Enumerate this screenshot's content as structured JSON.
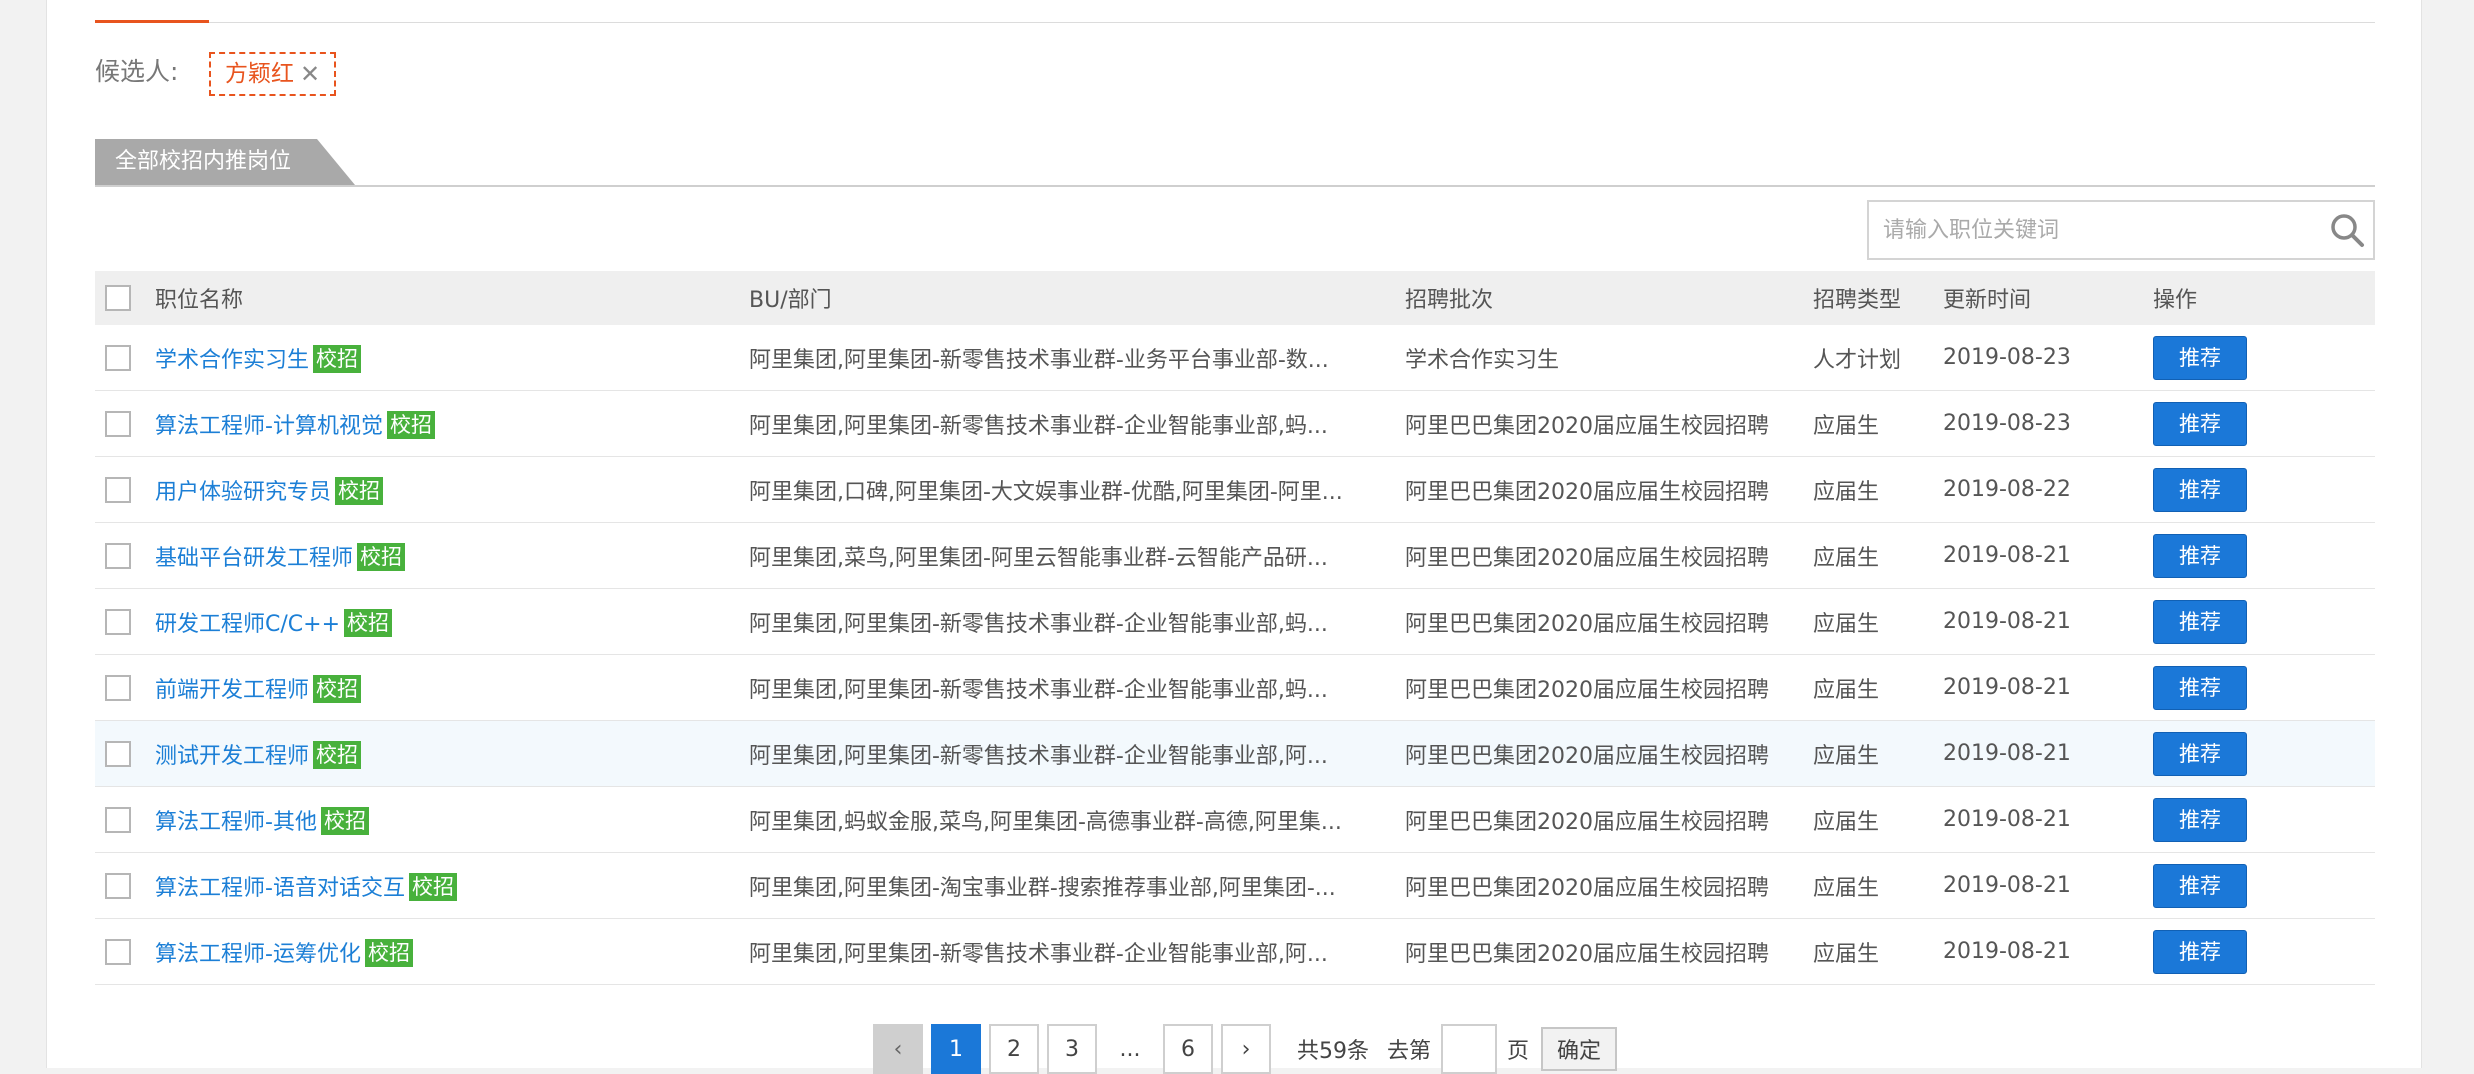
{
  "candidate": {
    "label": "候选人:",
    "name": "方颖红",
    "remove": "✕"
  },
  "section": {
    "title": "全部校招内推岗位"
  },
  "search": {
    "placeholder": "请输入职位关键词"
  },
  "table": {
    "headers": {
      "name": "职位名称",
      "bu": "BU/部门",
      "batch": "招聘批次",
      "type": "招聘类型",
      "updated": "更新时间",
      "action": "操作"
    },
    "badge": "校招",
    "action_label": "推荐",
    "rows": [
      {
        "name": "学术合作实习生",
        "bu": "阿里集团,阿里集团-新零售技术事业群-业务平台事业部-数...",
        "batch": "学术合作实习生",
        "type": "人才计划",
        "updated": "2019-08-23"
      },
      {
        "name": "算法工程师-计算机视觉",
        "bu": "阿里集团,阿里集团-新零售技术事业群-企业智能事业部,蚂...",
        "batch": "阿里巴巴集团2020届应届生校园招聘",
        "type": "应届生",
        "updated": "2019-08-23"
      },
      {
        "name": "用户体验研究专员",
        "bu": "阿里集团,口碑,阿里集团-大文娱事业群-优酷,阿里集团-阿里...",
        "batch": "阿里巴巴集团2020届应届生校园招聘",
        "type": "应届生",
        "updated": "2019-08-22"
      },
      {
        "name": "基础平台研发工程师",
        "bu": "阿里集团,菜鸟,阿里集团-阿里云智能事业群-云智能产品研...",
        "batch": "阿里巴巴集团2020届应届生校园招聘",
        "type": "应届生",
        "updated": "2019-08-21"
      },
      {
        "name": "研发工程师C/C++",
        "bu": "阿里集团,阿里集团-新零售技术事业群-企业智能事业部,蚂...",
        "batch": "阿里巴巴集团2020届应届生校园招聘",
        "type": "应届生",
        "updated": "2019-08-21"
      },
      {
        "name": "前端开发工程师",
        "bu": "阿里集团,阿里集团-新零售技术事业群-企业智能事业部,蚂...",
        "batch": "阿里巴巴集团2020届应届生校园招聘",
        "type": "应届生",
        "updated": "2019-08-21"
      },
      {
        "name": "测试开发工程师",
        "bu": "阿里集团,阿里集团-新零售技术事业群-企业智能事业部,阿...",
        "batch": "阿里巴巴集团2020届应届生校园招聘",
        "type": "应届生",
        "updated": "2019-08-21"
      },
      {
        "name": "算法工程师-其他",
        "bu": "阿里集团,蚂蚁金服,菜鸟,阿里集团-高德事业群-高德,阿里集...",
        "batch": "阿里巴巴集团2020届应届生校园招聘",
        "type": "应届生",
        "updated": "2019-08-21"
      },
      {
        "name": "算法工程师-语音对话交互",
        "bu": "阿里集团,阿里集团-淘宝事业群-搜索推荐事业部,阿里集团-...",
        "batch": "阿里巴巴集团2020届应届生校园招聘",
        "type": "应届生",
        "updated": "2019-08-21"
      },
      {
        "name": "算法工程师-运筹优化",
        "bu": "阿里集团,阿里集团-新零售技术事业群-企业智能事业部,阿...",
        "batch": "阿里巴巴集团2020届应届生校园招聘",
        "type": "应届生",
        "updated": "2019-08-21"
      }
    ]
  },
  "pagination": {
    "prev": "‹",
    "next": "›",
    "pages": [
      "1",
      "2",
      "3"
    ],
    "ellipsis": "...",
    "last": "6",
    "total": "共59条",
    "goto_prefix": "去第",
    "goto_suffix": "页",
    "confirm": "确定"
  }
}
